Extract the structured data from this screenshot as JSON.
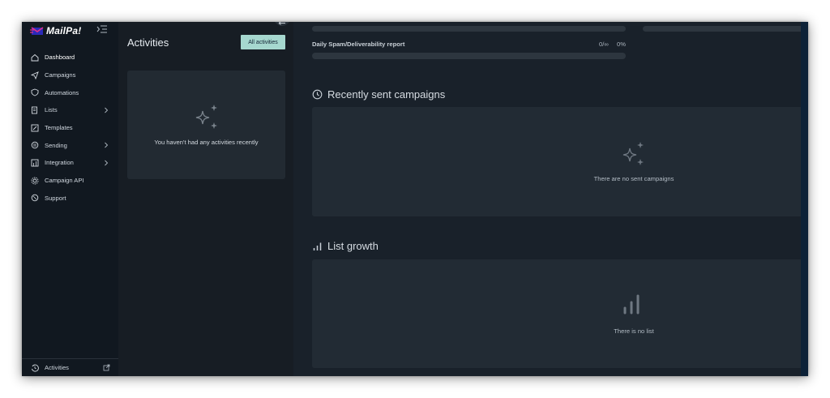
{
  "app": {
    "brand": "MailPa!"
  },
  "sidebar": {
    "items": [
      {
        "label": "Dashboard",
        "icon": "home-icon",
        "active": true,
        "has_submenu": false
      },
      {
        "label": "Campaigns",
        "icon": "send-icon",
        "active": false,
        "has_submenu": false
      },
      {
        "label": "Automations",
        "icon": "shield-icon",
        "active": false,
        "has_submenu": false
      },
      {
        "label": "Lists",
        "icon": "list-icon",
        "active": false,
        "has_submenu": true
      },
      {
        "label": "Templates",
        "icon": "edit-icon",
        "active": false,
        "has_submenu": false
      },
      {
        "label": "Sending",
        "icon": "sync-icon",
        "active": false,
        "has_submenu": true
      },
      {
        "label": "Integration",
        "icon": "plug-icon",
        "active": false,
        "has_submenu": true
      },
      {
        "label": "Campaign API",
        "icon": "gear-icon",
        "active": false,
        "has_submenu": false
      },
      {
        "label": "Support",
        "icon": "support-icon",
        "active": false,
        "has_submenu": false
      }
    ],
    "footer": {
      "label": "Activities",
      "icon": "history-icon"
    }
  },
  "activities": {
    "title": "Activities",
    "button_label": "All activities",
    "empty_message": "You haven't had any activities recently"
  },
  "main": {
    "spam_report": {
      "label": "Daily Spam/Deliverability report",
      "count": "0/∞",
      "percent": "0%"
    },
    "recent": {
      "title": "Recently sent campaigns",
      "empty_message": "There are no sent campaigns"
    },
    "growth": {
      "title": "List growth",
      "empty_message": "There is no list"
    }
  },
  "colors": {
    "accent": "#a6d8cf",
    "sidebar_bg": "#111820",
    "panel_bg": "#171d24",
    "main_bg": "#19212a",
    "card_bg": "#222b34"
  }
}
